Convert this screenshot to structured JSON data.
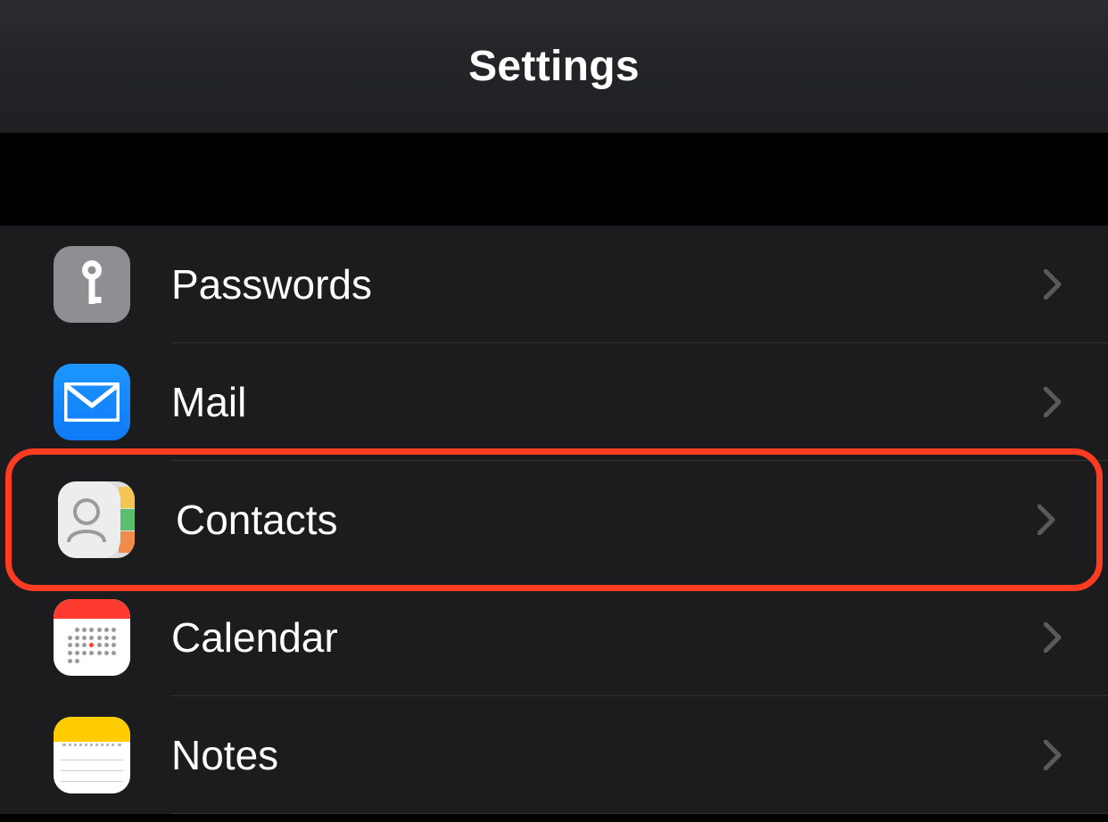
{
  "header": {
    "title": "Settings"
  },
  "rows": [
    {
      "id": "passwords",
      "label": "Passwords",
      "icon": "key-icon",
      "highlighted": false
    },
    {
      "id": "mail",
      "label": "Mail",
      "icon": "envelope-icon",
      "highlighted": false
    },
    {
      "id": "contacts",
      "label": "Contacts",
      "icon": "contacts-icon",
      "highlighted": true
    },
    {
      "id": "calendar",
      "label": "Calendar",
      "icon": "calendar-icon",
      "highlighted": false
    },
    {
      "id": "notes",
      "label": "Notes",
      "icon": "notes-icon",
      "highlighted": false
    }
  ],
  "colors": {
    "highlight": "#ff3b22",
    "background_header": "#232428",
    "background_list": "#1c1c1e",
    "chevron": "#5a5a5e"
  }
}
